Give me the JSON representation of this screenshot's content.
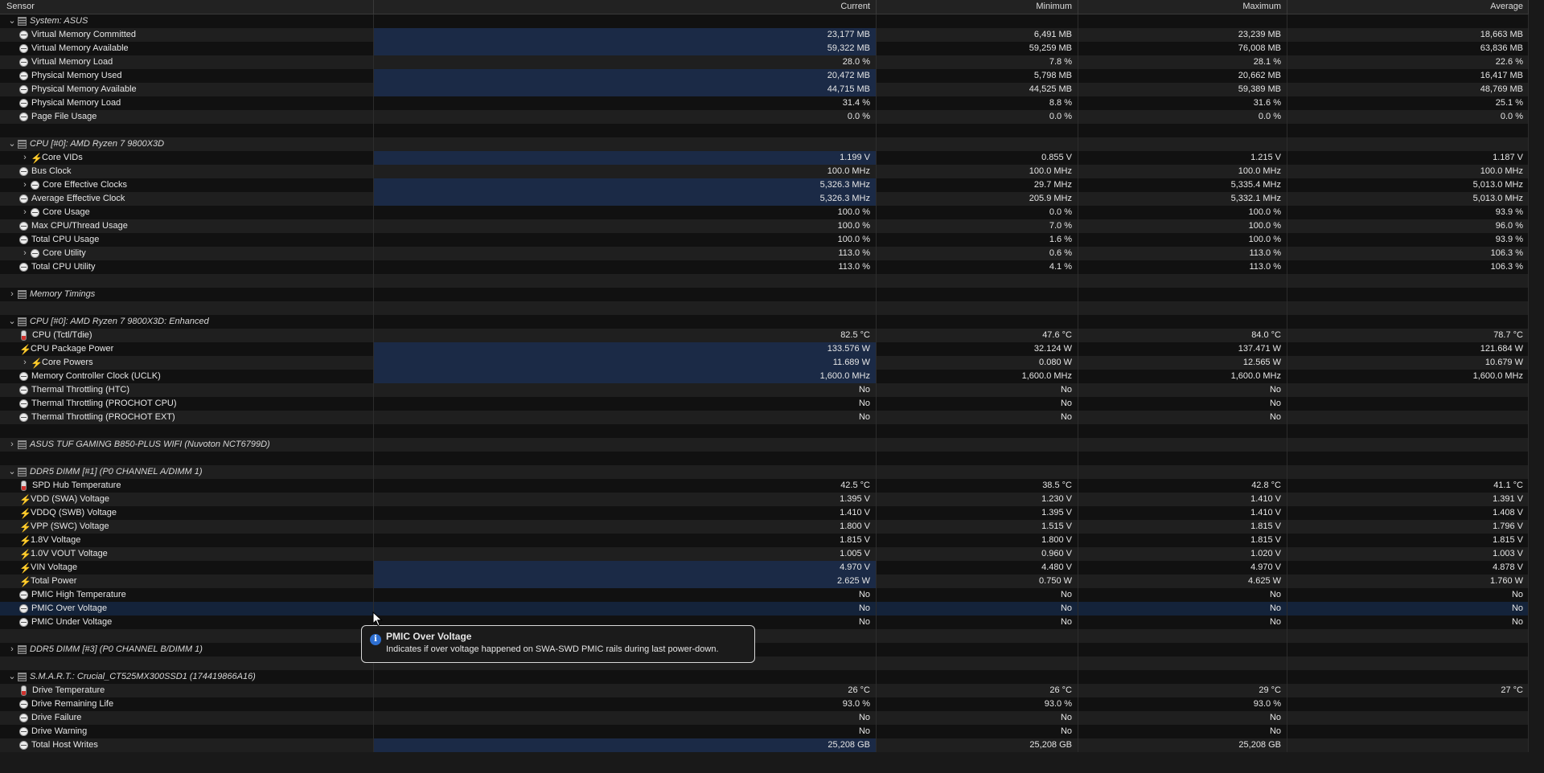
{
  "columns": {
    "sensor": "Sensor",
    "current": "Current",
    "minimum": "Minimum",
    "maximum": "Maximum",
    "average": "Average"
  },
  "rows": [
    {
      "type": "group",
      "expanded": true,
      "icon": "chip",
      "label": "System: ASUS"
    },
    {
      "icon": "gauge",
      "label": "Virtual Memory Committed",
      "cur": "23,177 MB",
      "min": "6,491 MB",
      "max": "23,239 MB",
      "avg": "18,663 MB",
      "hl": true
    },
    {
      "icon": "gauge",
      "label": "Virtual Memory Available",
      "cur": "59,322 MB",
      "min": "59,259 MB",
      "max": "76,008 MB",
      "avg": "63,836 MB",
      "hl": true
    },
    {
      "icon": "gauge",
      "label": "Virtual Memory Load",
      "cur": "28.0 %",
      "min": "7.8 %",
      "max": "28.1 %",
      "avg": "22.6 %"
    },
    {
      "icon": "gauge",
      "label": "Physical Memory Used",
      "cur": "20,472 MB",
      "min": "5,798 MB",
      "max": "20,662 MB",
      "avg": "16,417 MB",
      "hl": true
    },
    {
      "icon": "gauge",
      "label": "Physical Memory Available",
      "cur": "44,715 MB",
      "min": "44,525 MB",
      "max": "59,389 MB",
      "avg": "48,769 MB",
      "hl": true
    },
    {
      "icon": "gauge",
      "label": "Physical Memory Load",
      "cur": "31.4 %",
      "min": "8.8 %",
      "max": "31.6 %",
      "avg": "25.1 %"
    },
    {
      "icon": "gauge",
      "label": "Page File Usage",
      "cur": "0.0 %",
      "min": "0.0 %",
      "max": "0.0 %",
      "avg": "0.0 %"
    },
    {
      "type": "spacer"
    },
    {
      "type": "group",
      "expanded": true,
      "icon": "chip",
      "label": "CPU [#0]: AMD Ryzen 7 9800X3D"
    },
    {
      "icon": "bolt",
      "label": "Core VIDs",
      "expandable": true,
      "cur": "1.199 V",
      "min": "0.855 V",
      "max": "1.215 V",
      "avg": "1.187 V",
      "hl": true
    },
    {
      "icon": "gauge",
      "label": "Bus Clock",
      "cur": "100.0 MHz",
      "min": "100.0 MHz",
      "max": "100.0 MHz",
      "avg": "100.0 MHz"
    },
    {
      "icon": "gauge",
      "label": "Core Effective Clocks",
      "expandable": true,
      "cur": "5,326.3 MHz",
      "min": "29.7 MHz",
      "max": "5,335.4 MHz",
      "avg": "5,013.0 MHz",
      "hl": true
    },
    {
      "icon": "gauge",
      "label": "Average Effective Clock",
      "cur": "5,326.3 MHz",
      "min": "205.9 MHz",
      "max": "5,332.1 MHz",
      "avg": "5,013.0 MHz",
      "hl": true
    },
    {
      "icon": "gauge",
      "label": "Core Usage",
      "expandable": true,
      "cur": "100.0 %",
      "min": "0.0 %",
      "max": "100.0 %",
      "avg": "93.9 %"
    },
    {
      "icon": "gauge",
      "label": "Max CPU/Thread Usage",
      "cur": "100.0 %",
      "min": "7.0 %",
      "max": "100.0 %",
      "avg": "96.0 %"
    },
    {
      "icon": "gauge",
      "label": "Total CPU Usage",
      "cur": "100.0 %",
      "min": "1.6 %",
      "max": "100.0 %",
      "avg": "93.9 %"
    },
    {
      "icon": "gauge",
      "label": "Core Utility",
      "expandable": true,
      "cur": "113.0 %",
      "min": "0.6 %",
      "max": "113.0 %",
      "avg": "106.3 %"
    },
    {
      "icon": "gauge",
      "label": "Total CPU Utility",
      "cur": "113.0 %",
      "min": "4.1 %",
      "max": "113.0 %",
      "avg": "106.3 %"
    },
    {
      "type": "spacer"
    },
    {
      "type": "group",
      "expanded": false,
      "icon": "chip",
      "label": "Memory Timings"
    },
    {
      "type": "spacer"
    },
    {
      "type": "group",
      "expanded": true,
      "icon": "chip",
      "label": "CPU [#0]: AMD Ryzen 7 9800X3D: Enhanced"
    },
    {
      "icon": "therm",
      "label": "CPU (Tctl/Tdie)",
      "cur": "82.5 °C",
      "min": "47.6 °C",
      "max": "84.0 °C",
      "avg": "78.7 °C"
    },
    {
      "icon": "bolt",
      "label": "CPU Package Power",
      "cur": "133.576 W",
      "min": "32.124 W",
      "max": "137.471 W",
      "avg": "121.684 W",
      "hl": true
    },
    {
      "icon": "bolt",
      "label": "Core Powers",
      "expandable": true,
      "cur": "11.689 W",
      "min": "0.080 W",
      "max": "12.565 W",
      "avg": "10.679 W",
      "hl": true
    },
    {
      "icon": "gauge",
      "label": "Memory Controller Clock (UCLK)",
      "cur": "1,600.0 MHz",
      "min": "1,600.0 MHz",
      "max": "1,600.0 MHz",
      "avg": "1,600.0 MHz",
      "hl": true
    },
    {
      "icon": "gauge",
      "label": "Thermal Throttling (HTC)",
      "cur": "No",
      "min": "No",
      "max": "No",
      "avg": ""
    },
    {
      "icon": "gauge",
      "label": "Thermal Throttling (PROCHOT CPU)",
      "cur": "No",
      "min": "No",
      "max": "No",
      "avg": ""
    },
    {
      "icon": "gauge",
      "label": "Thermal Throttling (PROCHOT EXT)",
      "cur": "No",
      "min": "No",
      "max": "No",
      "avg": ""
    },
    {
      "type": "spacer"
    },
    {
      "type": "group",
      "expanded": false,
      "icon": "chip",
      "label": "ASUS TUF GAMING B850-PLUS WIFI (Nuvoton NCT6799D)"
    },
    {
      "type": "spacer"
    },
    {
      "type": "group",
      "expanded": true,
      "icon": "chip",
      "label": "DDR5 DIMM [#1] (P0 CHANNEL A/DIMM 1)"
    },
    {
      "icon": "therm",
      "label": "SPD Hub Temperature",
      "cur": "42.5 °C",
      "min": "38.5 °C",
      "max": "42.8 °C",
      "avg": "41.1 °C"
    },
    {
      "icon": "bolt",
      "label": "VDD (SWA) Voltage",
      "cur": "1.395 V",
      "min": "1.230 V",
      "max": "1.410 V",
      "avg": "1.391 V"
    },
    {
      "icon": "bolt",
      "label": "VDDQ (SWB) Voltage",
      "cur": "1.410 V",
      "min": "1.395 V",
      "max": "1.410 V",
      "avg": "1.408 V"
    },
    {
      "icon": "bolt",
      "label": "VPP (SWC) Voltage",
      "cur": "1.800 V",
      "min": "1.515 V",
      "max": "1.815 V",
      "avg": "1.796 V"
    },
    {
      "icon": "bolt",
      "label": "1.8V Voltage",
      "cur": "1.815 V",
      "min": "1.800 V",
      "max": "1.815 V",
      "avg": "1.815 V"
    },
    {
      "icon": "bolt",
      "label": "1.0V VOUT Voltage",
      "cur": "1.005 V",
      "min": "0.960 V",
      "max": "1.020 V",
      "avg": "1.003 V"
    },
    {
      "icon": "bolt",
      "label": "VIN Voltage",
      "cur": "4.970 V",
      "min": "4.480 V",
      "max": "4.970 V",
      "avg": "4.878 V",
      "hl": true
    },
    {
      "icon": "bolt",
      "label": "Total Power",
      "cur": "2.625 W",
      "min": "0.750 W",
      "max": "4.625 W",
      "avg": "1.760 W",
      "hl": true
    },
    {
      "icon": "gauge",
      "label": "PMIC High Temperature",
      "cur": "No",
      "min": "No",
      "max": "No",
      "avg": "No"
    },
    {
      "icon": "gauge",
      "label": "PMIC Over Voltage",
      "cur": "No",
      "min": "No",
      "max": "No",
      "avg": "No",
      "sel": true
    },
    {
      "icon": "gauge",
      "label": "PMIC Under Voltage",
      "cur": "No",
      "min": "No",
      "max": "No",
      "avg": "No"
    },
    {
      "type": "spacer"
    },
    {
      "type": "group",
      "expanded": false,
      "icon": "chip",
      "label": "DDR5 DIMM [#3] (P0 CHANNEL B/DIMM 1)"
    },
    {
      "type": "spacer"
    },
    {
      "type": "group",
      "expanded": true,
      "icon": "chip",
      "label": "S.M.A.R.T.: Crucial_CT525MX300SSD1 (174419866A16)"
    },
    {
      "icon": "therm",
      "label": "Drive Temperature",
      "cur": "26 °C",
      "min": "26 °C",
      "max": "29 °C",
      "avg": "27 °C"
    },
    {
      "icon": "gauge",
      "label": "Drive Remaining Life",
      "cur": "93.0 %",
      "min": "93.0 %",
      "max": "93.0 %",
      "avg": ""
    },
    {
      "icon": "gauge",
      "label": "Drive Failure",
      "cur": "No",
      "min": "No",
      "max": "No",
      "avg": ""
    },
    {
      "icon": "gauge",
      "label": "Drive Warning",
      "cur": "No",
      "min": "No",
      "max": "No",
      "avg": ""
    },
    {
      "icon": "gauge",
      "label": "Total Host Writes",
      "cur": "25,208 GB",
      "min": "25,208 GB",
      "max": "25,208 GB",
      "avg": "",
      "hl": true
    }
  ],
  "tooltip": {
    "title": "PMIC Over Voltage",
    "text": "Indicates if over voltage happened on SWA-SWD PMIC rails during last power-down.",
    "icon": "info-icon"
  }
}
